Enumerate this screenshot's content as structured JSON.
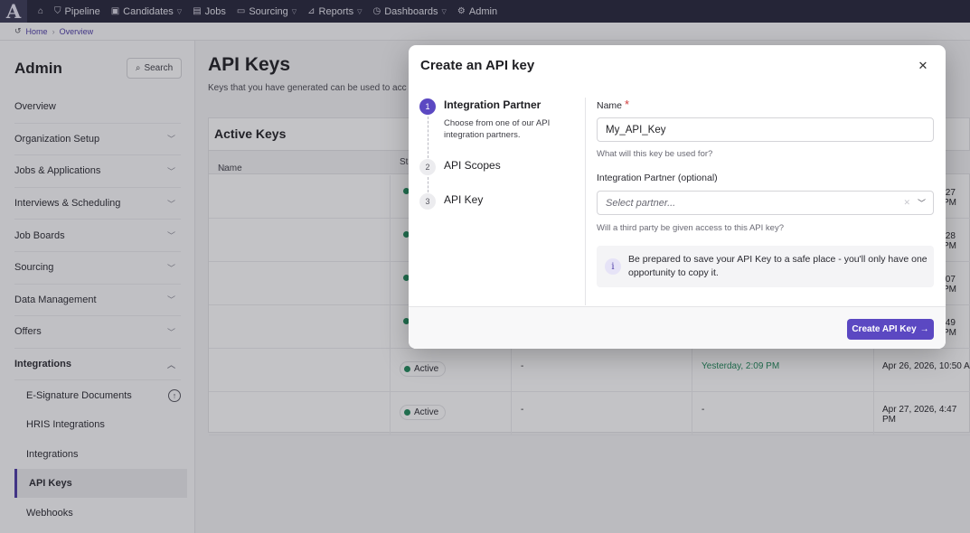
{
  "nav": {
    "logo": "A",
    "items": [
      {
        "label": "",
        "icon": "home-icon"
      },
      {
        "label": "Pipeline",
        "icon": "filter-icon"
      },
      {
        "label": "Candidates",
        "icon": "candidates-icon",
        "chevron": true
      },
      {
        "label": "Jobs",
        "icon": "briefcase-icon"
      },
      {
        "label": "Sourcing",
        "icon": "sourcing-icon",
        "chevron": true
      },
      {
        "label": "Reports",
        "icon": "chart-icon",
        "chevron": true
      },
      {
        "label": "Dashboards",
        "icon": "dashboard-icon",
        "chevron": true
      },
      {
        "label": "Admin",
        "icon": "gear-icon"
      }
    ]
  },
  "breadcrumb": {
    "home": "Home",
    "current": "Overview"
  },
  "sidebar": {
    "title": "Admin",
    "search_label": "Search",
    "items": [
      {
        "label": "Overview"
      },
      {
        "label": "Organization Setup"
      },
      {
        "label": "Jobs & Applications"
      },
      {
        "label": "Interviews & Scheduling"
      },
      {
        "label": "Job Boards"
      },
      {
        "label": "Sourcing"
      },
      {
        "label": "Data Management"
      },
      {
        "label": "Offers"
      },
      {
        "label": "Integrations"
      }
    ],
    "sub_items": [
      {
        "label": "E-Signature Documents"
      },
      {
        "label": "HRIS Integrations"
      },
      {
        "label": "Integrations"
      },
      {
        "label": "API Keys"
      },
      {
        "label": "Webhooks"
      }
    ]
  },
  "main": {
    "title": "API Keys",
    "description": "Keys that you have generated can be used to access",
    "panel_title": "Active Keys",
    "columns": [
      "Name",
      "Sta"
    ],
    "rows": [
      {
        "status": "",
        "col3": "",
        "col4": "",
        "date": ":27 PM"
      },
      {
        "status": "",
        "col3": "",
        "col4": "",
        "date": ":28 PM"
      },
      {
        "status": "",
        "col3": "",
        "col4": "",
        "date": ":07 PM"
      },
      {
        "status": "",
        "col3": "",
        "col4": "",
        "date": ":49 PM"
      },
      {
        "status": "Active",
        "col3": "-",
        "col4": "Yesterday, 2:09 PM",
        "date": "Apr 26, 2026, 10:50 A"
      },
      {
        "status": "Active",
        "col3": "-",
        "col4": "-",
        "date": "Apr 27, 2026, 4:47 PM"
      }
    ]
  },
  "modal": {
    "title": "Create an API key",
    "steps": [
      {
        "num": "1",
        "label": "Integration Partner",
        "desc": "Choose from one of our API integration partners."
      },
      {
        "num": "2",
        "label": "API Scopes"
      },
      {
        "num": "3",
        "label": "API Key"
      }
    ],
    "name_label": "Name",
    "name_required": "*",
    "name_value": "My_API_Key",
    "name_help": "What will this key be used for?",
    "partner_label": "Integration Partner (optional)",
    "partner_placeholder": "Select partner...",
    "partner_help": "Will a third party be given access to this API key?",
    "info_text": "Be prepared to save your API Key to a safe place - you'll only have one opportunity to copy it.",
    "primary_button": "Create API Key",
    "colors": {
      "accent": "#5b48c2",
      "active_status": "#1f8a5a"
    }
  }
}
